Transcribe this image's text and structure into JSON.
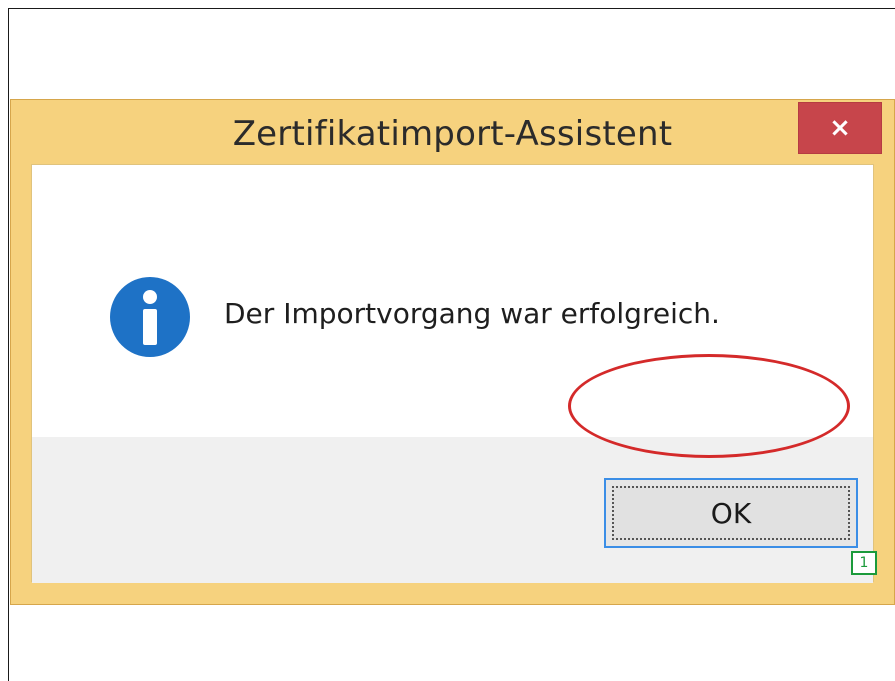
{
  "dialog": {
    "title": "Zertifikatimport-Assistent",
    "close_label": "×",
    "message": "Der Importvorgang war erfolgreich.",
    "icon": "info-icon",
    "ok_label": "OK"
  },
  "annotation": {
    "marker_number": "1"
  },
  "colors": {
    "frame": "#f6d27e",
    "close_button": "#c7454b",
    "info_icon": "#1e72c6",
    "highlight": "#d42a2a",
    "marker": "#1b9a3b"
  }
}
